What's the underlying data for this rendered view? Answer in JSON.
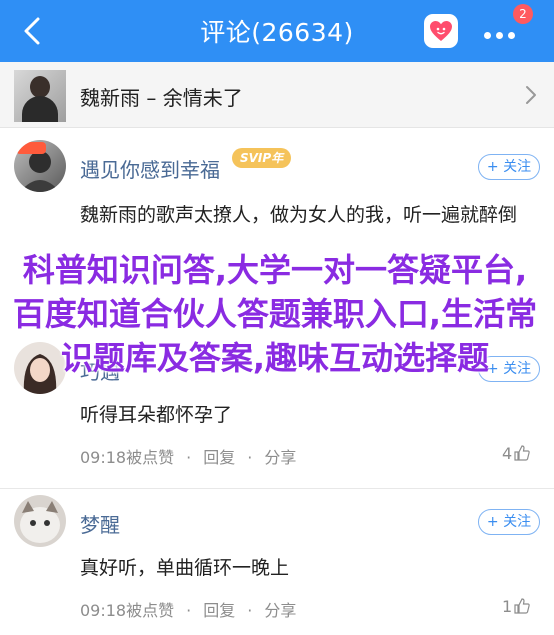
{
  "header": {
    "title": "评论(26634)",
    "notification_badge": "2"
  },
  "song": {
    "title": "魏新雨 – 余情未了"
  },
  "comments": [
    {
      "username": "遇见你感到幸福",
      "vip_badge": "SVIP年",
      "follow_label": "+ 关注",
      "text": "魏新雨的歌声太撩人，做为女人的我，听一遍就醉倒"
    },
    {
      "username": "巧遇",
      "follow_label": "+ 关注",
      "text": "听得耳朵都怀孕了",
      "time": "09:18被点赞",
      "reply": "回复",
      "share": "分享",
      "likes": "4"
    },
    {
      "username": "梦醒",
      "follow_label": "+ 关注",
      "text": "真好听，单曲循环一晚上",
      "time": "09:18被点赞",
      "reply": "回复",
      "share": "分享",
      "likes": "1"
    }
  ],
  "overlay_text": "科普知识问答,大学一对一答疑平台,百度知道合伙人答题兼职入口,生活常识题库及答案,趣味互动选择题",
  "colors": {
    "header_bg": "#2f8ff5",
    "username": "#4a6a95",
    "overlay": "#8a2be2",
    "follow": "#3b8ef0"
  }
}
